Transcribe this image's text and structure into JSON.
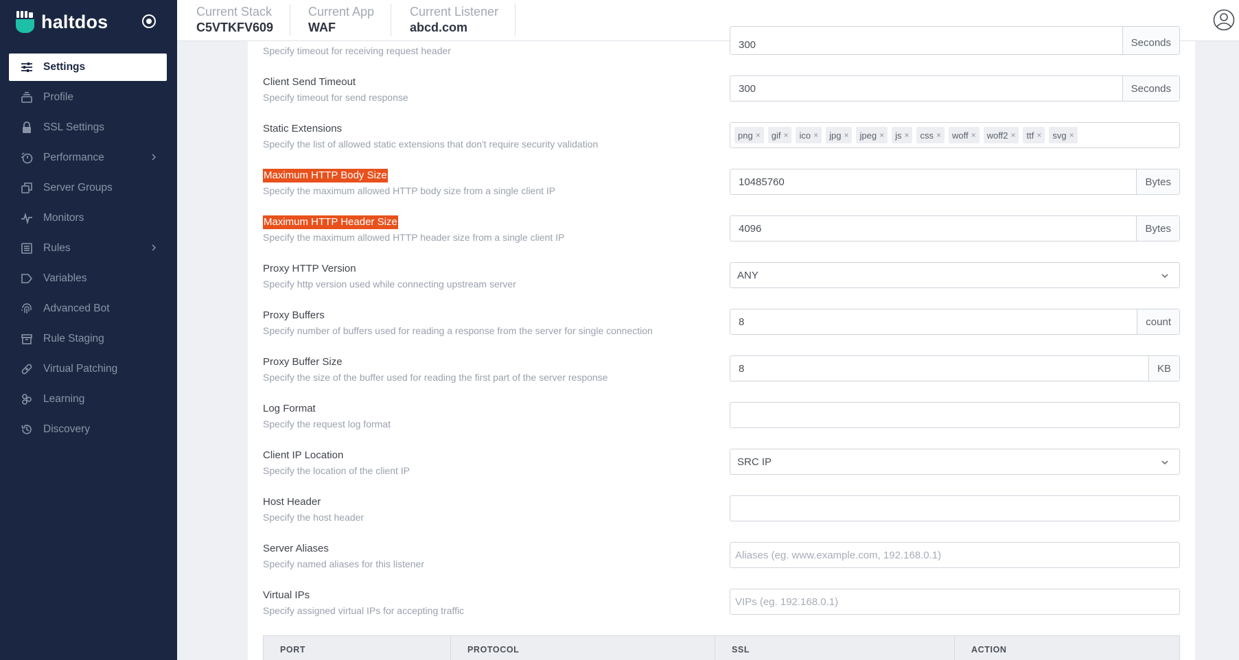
{
  "brand": {
    "name": "haltdos"
  },
  "sidebar": {
    "items": [
      {
        "label": "Settings",
        "icon": "sliders-icon",
        "active": true
      },
      {
        "label": "Profile",
        "icon": "stack-icon"
      },
      {
        "label": "SSL Settings",
        "icon": "lock-icon"
      },
      {
        "label": "Performance",
        "icon": "timer-icon",
        "submenu": true
      },
      {
        "label": "Server Groups",
        "icon": "copy-icon"
      },
      {
        "label": "Monitors",
        "icon": "pulse-icon"
      },
      {
        "label": "Rules",
        "icon": "list-icon",
        "submenu": true
      },
      {
        "label": "Variables",
        "icon": "tag-icon"
      },
      {
        "label": "Advanced Bot",
        "icon": "fingerprint-icon"
      },
      {
        "label": "Rule Staging",
        "icon": "archive-icon"
      },
      {
        "label": "Virtual Patching",
        "icon": "bandage-icon"
      },
      {
        "label": "Learning",
        "icon": "nodes-icon"
      },
      {
        "label": "Discovery",
        "icon": "history-icon"
      }
    ]
  },
  "topbar": {
    "stack_label": "Current Stack",
    "stack_value": "C5VTKFV609",
    "app_label": "Current App",
    "app_value": "WAF",
    "listener_label": "Current Listener",
    "listener_value": "abcd.com"
  },
  "form": {
    "partial": {
      "desc": "Specify timeout for receiving request header",
      "value": "300",
      "unit": "Seconds"
    },
    "client_send_timeout": {
      "title": "Client Send Timeout",
      "desc": "Specify timeout for send response",
      "value": "300",
      "unit": "Seconds"
    },
    "static_extensions": {
      "title": "Static Extensions",
      "desc": "Specify the list of allowed static extensions that don't require security validation",
      "tags": [
        "png",
        "gif",
        "ico",
        "jpg",
        "jpeg",
        "js",
        "css",
        "woff",
        "woff2",
        "ttf",
        "svg"
      ]
    },
    "max_body": {
      "title": "Maximum HTTP Body Size",
      "desc": "Specify the maximum allowed HTTP body size from a single client IP",
      "value": "10485760",
      "unit": "Bytes"
    },
    "max_header": {
      "title": "Maximum HTTP Header Size",
      "desc": "Specify the maximum allowed HTTP header size from a single client IP",
      "value": "4096",
      "unit": "Bytes"
    },
    "proxy_http_version": {
      "title": "Proxy HTTP Version",
      "desc": "Specify http version used while connecting upstream server",
      "value": "ANY"
    },
    "proxy_buffers": {
      "title": "Proxy Buffers",
      "desc": "Specify number of buffers used for reading a response from the server for single connection",
      "value": "8",
      "unit": "count"
    },
    "proxy_buffer_size": {
      "title": "Proxy Buffer Size",
      "desc": "Specify the size of the buffer used for reading the first part of the server response",
      "value": "8",
      "unit": "KB"
    },
    "log_format": {
      "title": "Log Format",
      "desc": "Specify the request log format",
      "value": ""
    },
    "client_ip_location": {
      "title": "Client IP Location",
      "desc": "Specify the location of the client IP",
      "value": "SRC IP"
    },
    "host_header": {
      "title": "Host Header",
      "desc": "Specify the host header",
      "value": ""
    },
    "server_aliases": {
      "title": "Server Aliases",
      "desc": "Specify named aliases for this listener",
      "placeholder": "Aliases (eg. www.example.com, 192.168.0.1)"
    },
    "virtual_ips": {
      "title": "Virtual IPs",
      "desc": "Specify assigned virtual IPs for accepting traffic",
      "placeholder": "VIPs (eg. 192.168.0.1)"
    }
  },
  "table": {
    "headers": [
      "PORT",
      "PROTOCOL",
      "SSL",
      "ACTION"
    ]
  },
  "colors": {
    "sidebar": "#1b2742",
    "highlight": "#e8511c",
    "brand_logo": "#1dbfa6"
  }
}
